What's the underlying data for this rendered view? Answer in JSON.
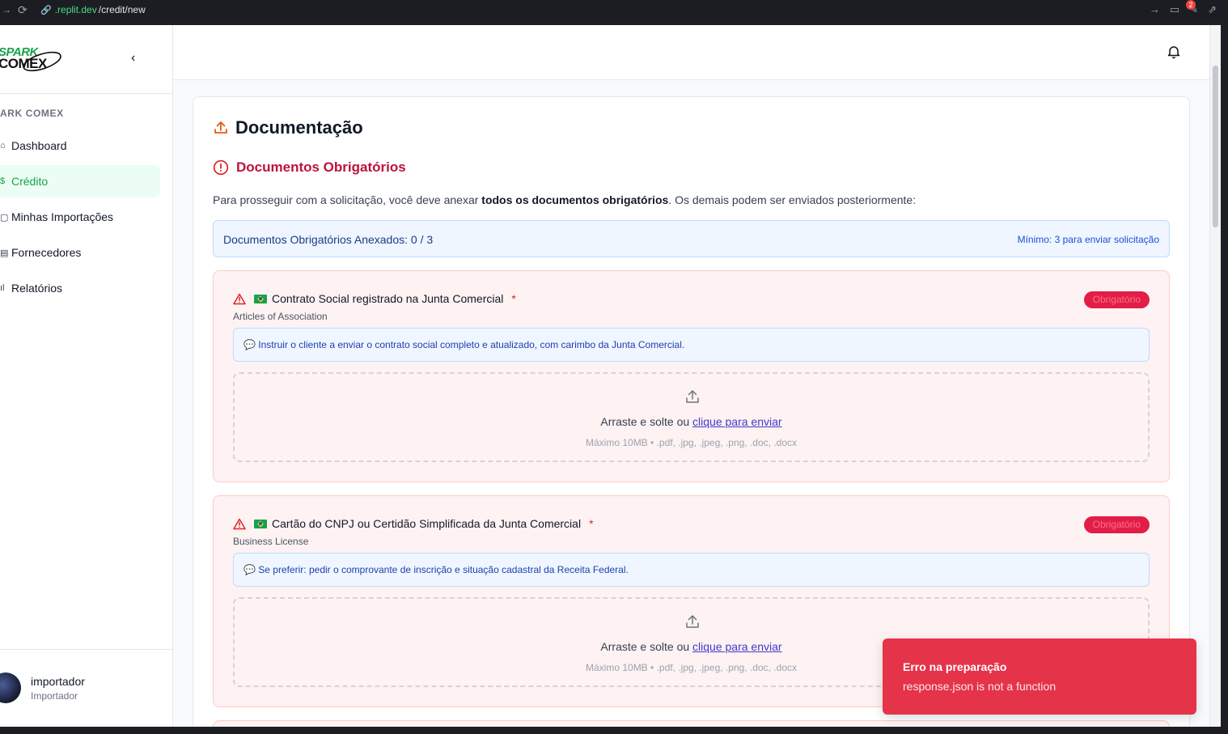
{
  "browser": {
    "url_host": ".replit.dev",
    "url_path": "/credit/new",
    "notification_count": "2"
  },
  "sidebar": {
    "logo_line1": "SPARK",
    "logo_line2": "COMEX",
    "section_label": "ARK COMEX",
    "items": [
      {
        "label": "Dashboard",
        "icon": "home-icon"
      },
      {
        "label": "Crédito",
        "icon": "credit-icon",
        "active": true
      },
      {
        "label": "Minhas Importações",
        "icon": "import-icon"
      },
      {
        "label": "Fornecedores",
        "icon": "building-icon"
      },
      {
        "label": "Relatórios",
        "icon": "chart-icon"
      }
    ],
    "user": {
      "name": "importador",
      "role": "Importador"
    }
  },
  "main": {
    "title": "Documentação",
    "required_title": "Documentos Obrigatórios",
    "intro_before": "Para prosseguir com a solicitação, você deve anexar ",
    "intro_bold": "todos os documentos obrigatórios",
    "intro_after": ". Os demais podem ser enviados posteriormente:",
    "counter_label": "Documentos Obrigatórios Anexados: 0 / 3",
    "counter_min": "Mínimo: 3 para enviar solicitação",
    "documents": [
      {
        "title": "Contrato Social registrado na Junta Comercial",
        "subtitle": "Articles of Association",
        "badge": "Obrigatório",
        "note": "💬 Instruir o cliente a enviar o contrato social completo e atualizado, com carimbo da Junta Comercial.",
        "drop_text": "Arraste e solte ou ",
        "drop_link": "clique para enviar",
        "drop_hint": "Máximo 10MB • .pdf, .jpg, .jpeg, .png, .doc, .docx"
      },
      {
        "title": "Cartão do CNPJ ou Certidão Simplificada da Junta Comercial",
        "subtitle": "Business License",
        "badge": "Obrigatório",
        "note": "💬 Se preferir: pedir o comprovante de inscrição e situação cadastral da Receita Federal.",
        "drop_text": "Arraste e solte ou ",
        "drop_link": "clique para enviar",
        "drop_hint": "Máximo 10MB • .pdf, .jpg, .jpeg, .png, .doc, .docx"
      }
    ]
  },
  "toast": {
    "title": "Erro na preparação",
    "message": "response.json is not a function"
  },
  "colors": {
    "brand_green": "#16a34a",
    "required_red": "#be123c",
    "toast_bg": "#e5334a",
    "info_blue": "#eff6ff"
  }
}
